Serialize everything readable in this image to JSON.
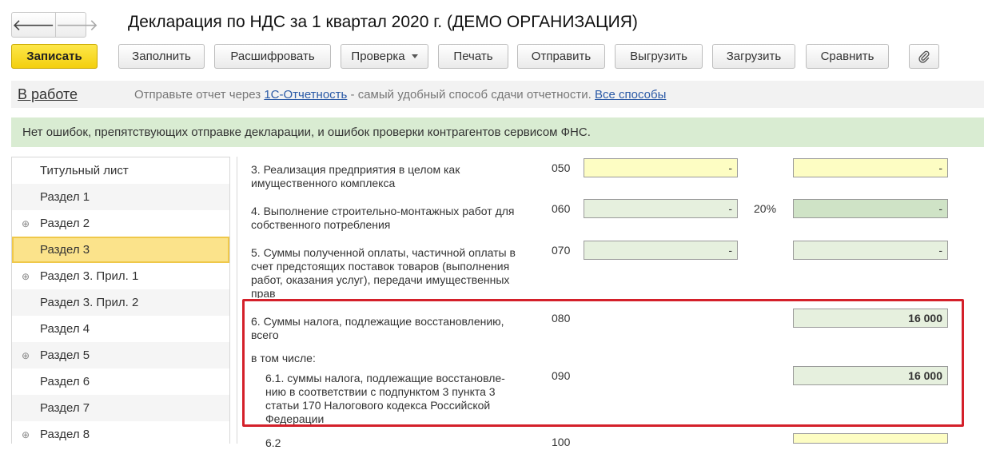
{
  "window": {
    "title": "Декларация по НДС за 1 квартал 2020 г. (ДЕМО ОРГАНИЗАЦИЯ)",
    "back_glyph": "🡐",
    "forward_glyph": "🡒"
  },
  "toolbar": {
    "save": "Записать",
    "fill": "Заполнить",
    "decode": "Расшифровать",
    "check": "Проверка",
    "print": "Печать",
    "send": "Отправить",
    "export": "Выгрузить",
    "import": "Загрузить",
    "compare": "Сравнить",
    "attach_icon": "paperclip-icon"
  },
  "status": {
    "label": "В работе",
    "note_prefix": "Отправьте отчет через ",
    "note_link": "1С-Отчетность",
    "note_middle": " - самый удобный способ сдачи отчетности. ",
    "note_link2": "Все способы"
  },
  "banner": {
    "text": "Нет ошибок, препятствующих отправке декларации, и ошибок проверки контрагентов сервисом ФНС."
  },
  "sidebar": {
    "items": [
      {
        "label": "Титульный лист",
        "expandable": false
      },
      {
        "label": "Раздел 1",
        "expandable": false
      },
      {
        "label": "Раздел 2",
        "expandable": true
      },
      {
        "label": "Раздел 3",
        "expandable": false,
        "selected": true
      },
      {
        "label": "Раздел 3. Прил. 1",
        "expandable": true
      },
      {
        "label": "Раздел 3. Прил. 2",
        "expandable": false
      },
      {
        "label": "Раздел 4",
        "expandable": false
      },
      {
        "label": "Раздел 5",
        "expandable": true
      },
      {
        "label": "Раздел 6",
        "expandable": false
      },
      {
        "label": "Раздел 7",
        "expandable": false
      },
      {
        "label": "Раздел 8",
        "expandable": true
      }
    ],
    "expand_glyph": "⊕"
  },
  "form": {
    "rows": [
      {
        "text": "3. Реализация предприятия в целом как имущественного комплекса",
        "code": "050",
        "base": "-",
        "tax": "-"
      },
      {
        "text": "4. Выполнение строительно-монтажных работ для собственного потребления",
        "code": "060",
        "base": "-",
        "rate": "20%",
        "tax": "-"
      },
      {
        "text": "5. Суммы полученной оплаты, частичной оплаты в счет предстоящих поставок товаров (выполнения работ, оказания услуг), передачи имущественных прав",
        "code": "070",
        "base": "-",
        "tax": "-"
      },
      {
        "text": "6. Суммы налога, подлежащие восстановлению, всего",
        "code": "080",
        "tax": "16 000"
      },
      {
        "text": "в том числе:"
      },
      {
        "text": "6.1. суммы налога, подлежащие восстановле-нию в соответствии с подпунктом 3 пункта 3 статьи 170 Налогового кодекса Российской Федерации",
        "code": "090",
        "tax": "16 000"
      },
      {
        "text": "6.2",
        "code": "100"
      }
    ]
  }
}
